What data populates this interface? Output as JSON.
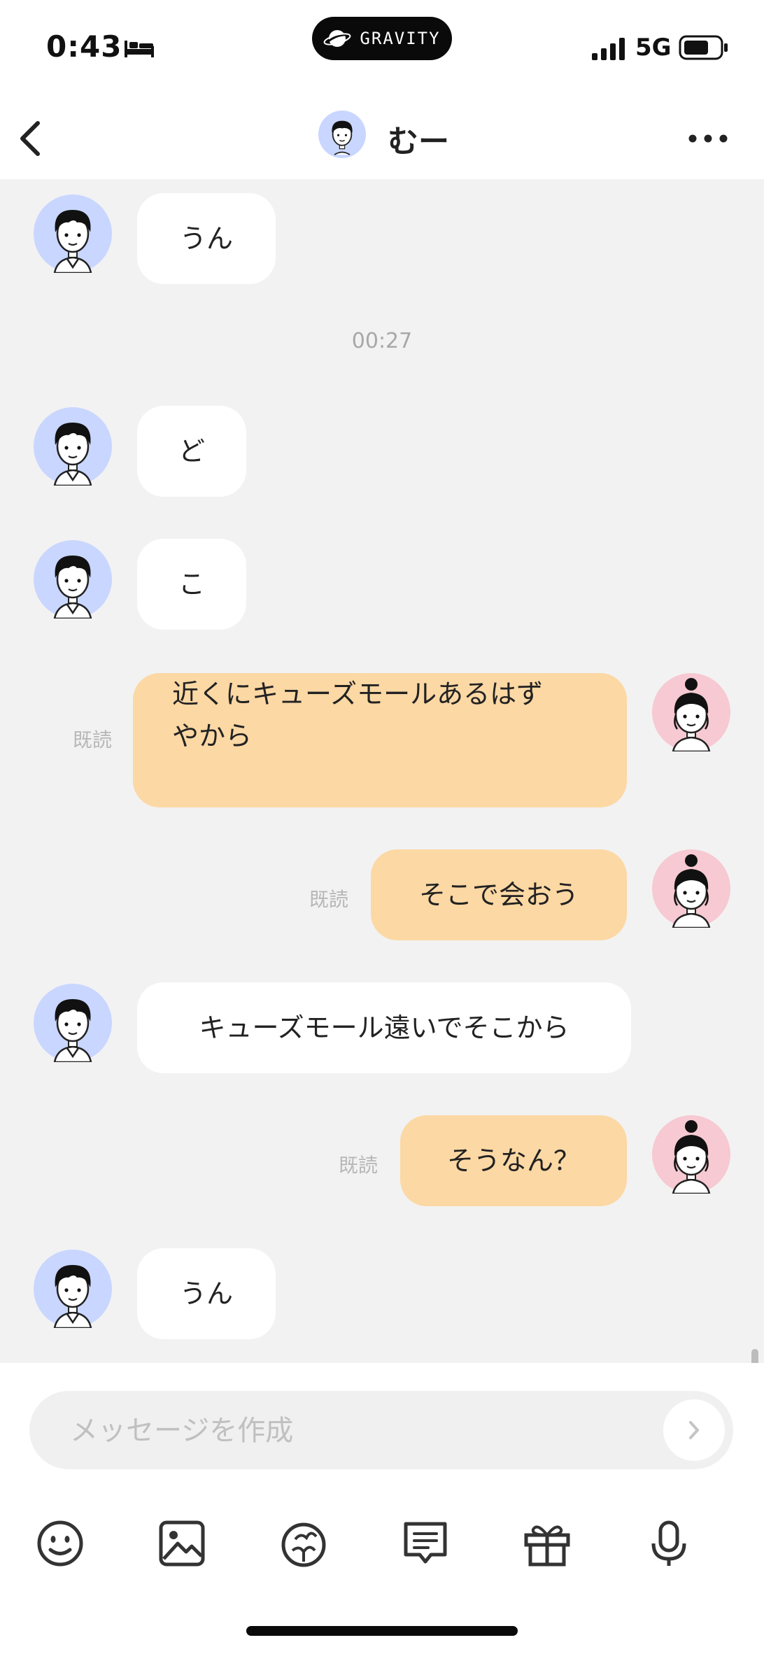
{
  "status_bar": {
    "time": "0:43",
    "network": "5G",
    "pill_text": "GRAVITY"
  },
  "header": {
    "contact_name": "むー"
  },
  "messages": [
    {
      "side": "them",
      "text": "うん"
    },
    {
      "type": "timestamp",
      "text": "00:27"
    },
    {
      "side": "them",
      "text": "ど"
    },
    {
      "side": "them",
      "text": "こ"
    },
    {
      "side": "me",
      "text": "近くにキューズモールあるはずやから",
      "line1": "近くにキューズモールあるはず",
      "line2": "やから",
      "read": "既読"
    },
    {
      "side": "me",
      "text": "そこで会おう",
      "read": "既読"
    },
    {
      "side": "them",
      "text": "キューズモール遠いでそこから"
    },
    {
      "side": "me",
      "text": "そうなん？",
      "read": "既読"
    },
    {
      "side": "them",
      "text": "うん"
    }
  ],
  "composer": {
    "placeholder": "メッセージを作成"
  },
  "toolbar": {
    "icons": [
      "emoji-icon",
      "image-icon",
      "sticker-icon",
      "quick-reply-icon",
      "gift-icon",
      "microphone-icon"
    ]
  },
  "colors": {
    "my_bubble": "#fcd8a4",
    "their_bubble": "#ffffff",
    "chat_bg": "#f2f2f2",
    "their_avatar_bg": "#c9d6ff",
    "my_avatar_bg": "#f7c9d2"
  }
}
